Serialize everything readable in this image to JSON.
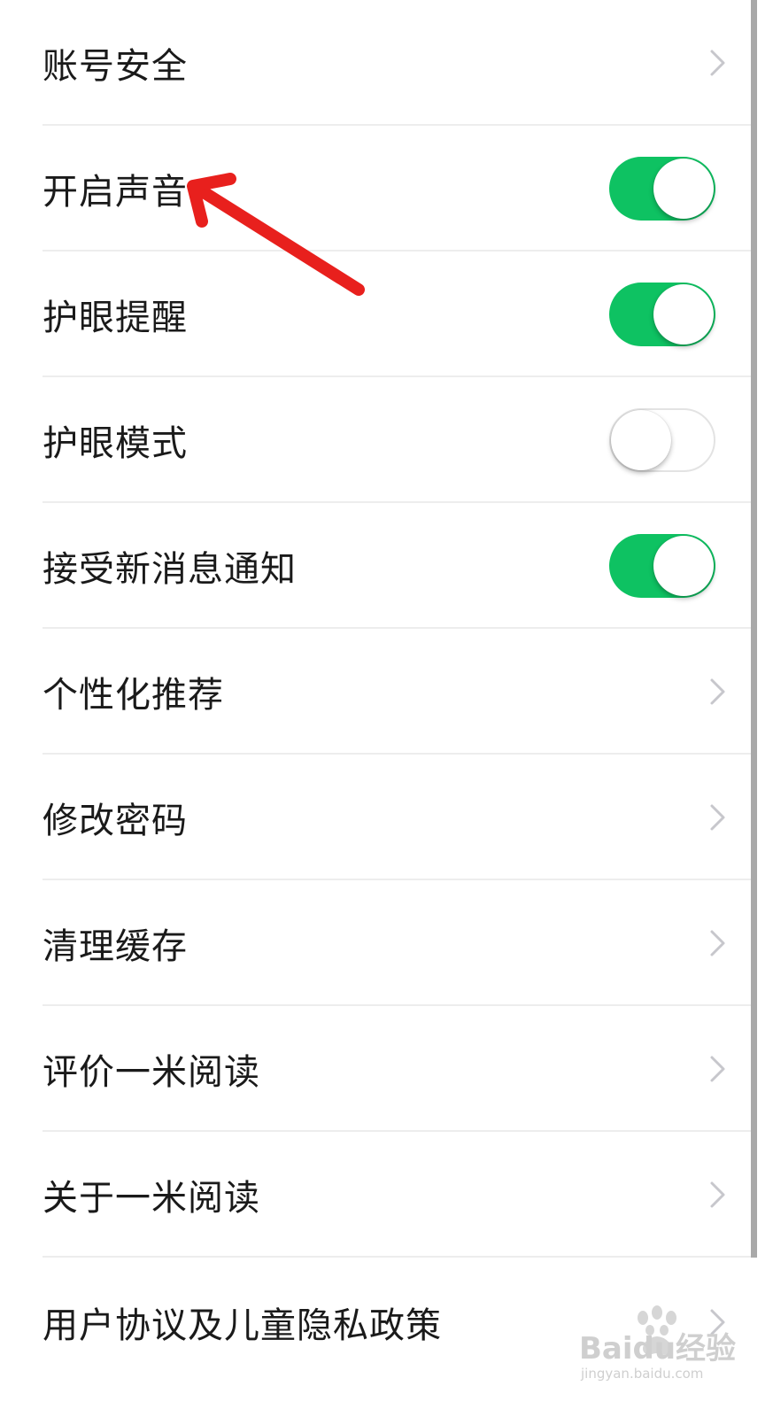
{
  "settings": {
    "items": [
      {
        "label": "账号安全",
        "control": "chevron"
      },
      {
        "label": "开启声音",
        "control": "toggle",
        "on": true
      },
      {
        "label": "护眼提醒",
        "control": "toggle",
        "on": true
      },
      {
        "label": "护眼模式",
        "control": "toggle",
        "on": false
      },
      {
        "label": "接受新消息通知",
        "control": "toggle",
        "on": true
      },
      {
        "label": "个性化推荐",
        "control": "chevron"
      },
      {
        "label": "修改密码",
        "control": "chevron"
      },
      {
        "label": "清理缓存",
        "control": "chevron"
      },
      {
        "label": "评价一米阅读",
        "control": "chevron"
      },
      {
        "label": "关于一米阅读",
        "control": "chevron"
      },
      {
        "label": "用户协议及儿童隐私政策",
        "control": "chevron"
      }
    ]
  },
  "watermark": {
    "text": "Baidu经验",
    "url": "jingyan.baidu.com"
  },
  "colors": {
    "toggle_on": "#0ec262",
    "annotation_arrow": "#e8201d",
    "chevron": "#c7c7cc"
  }
}
